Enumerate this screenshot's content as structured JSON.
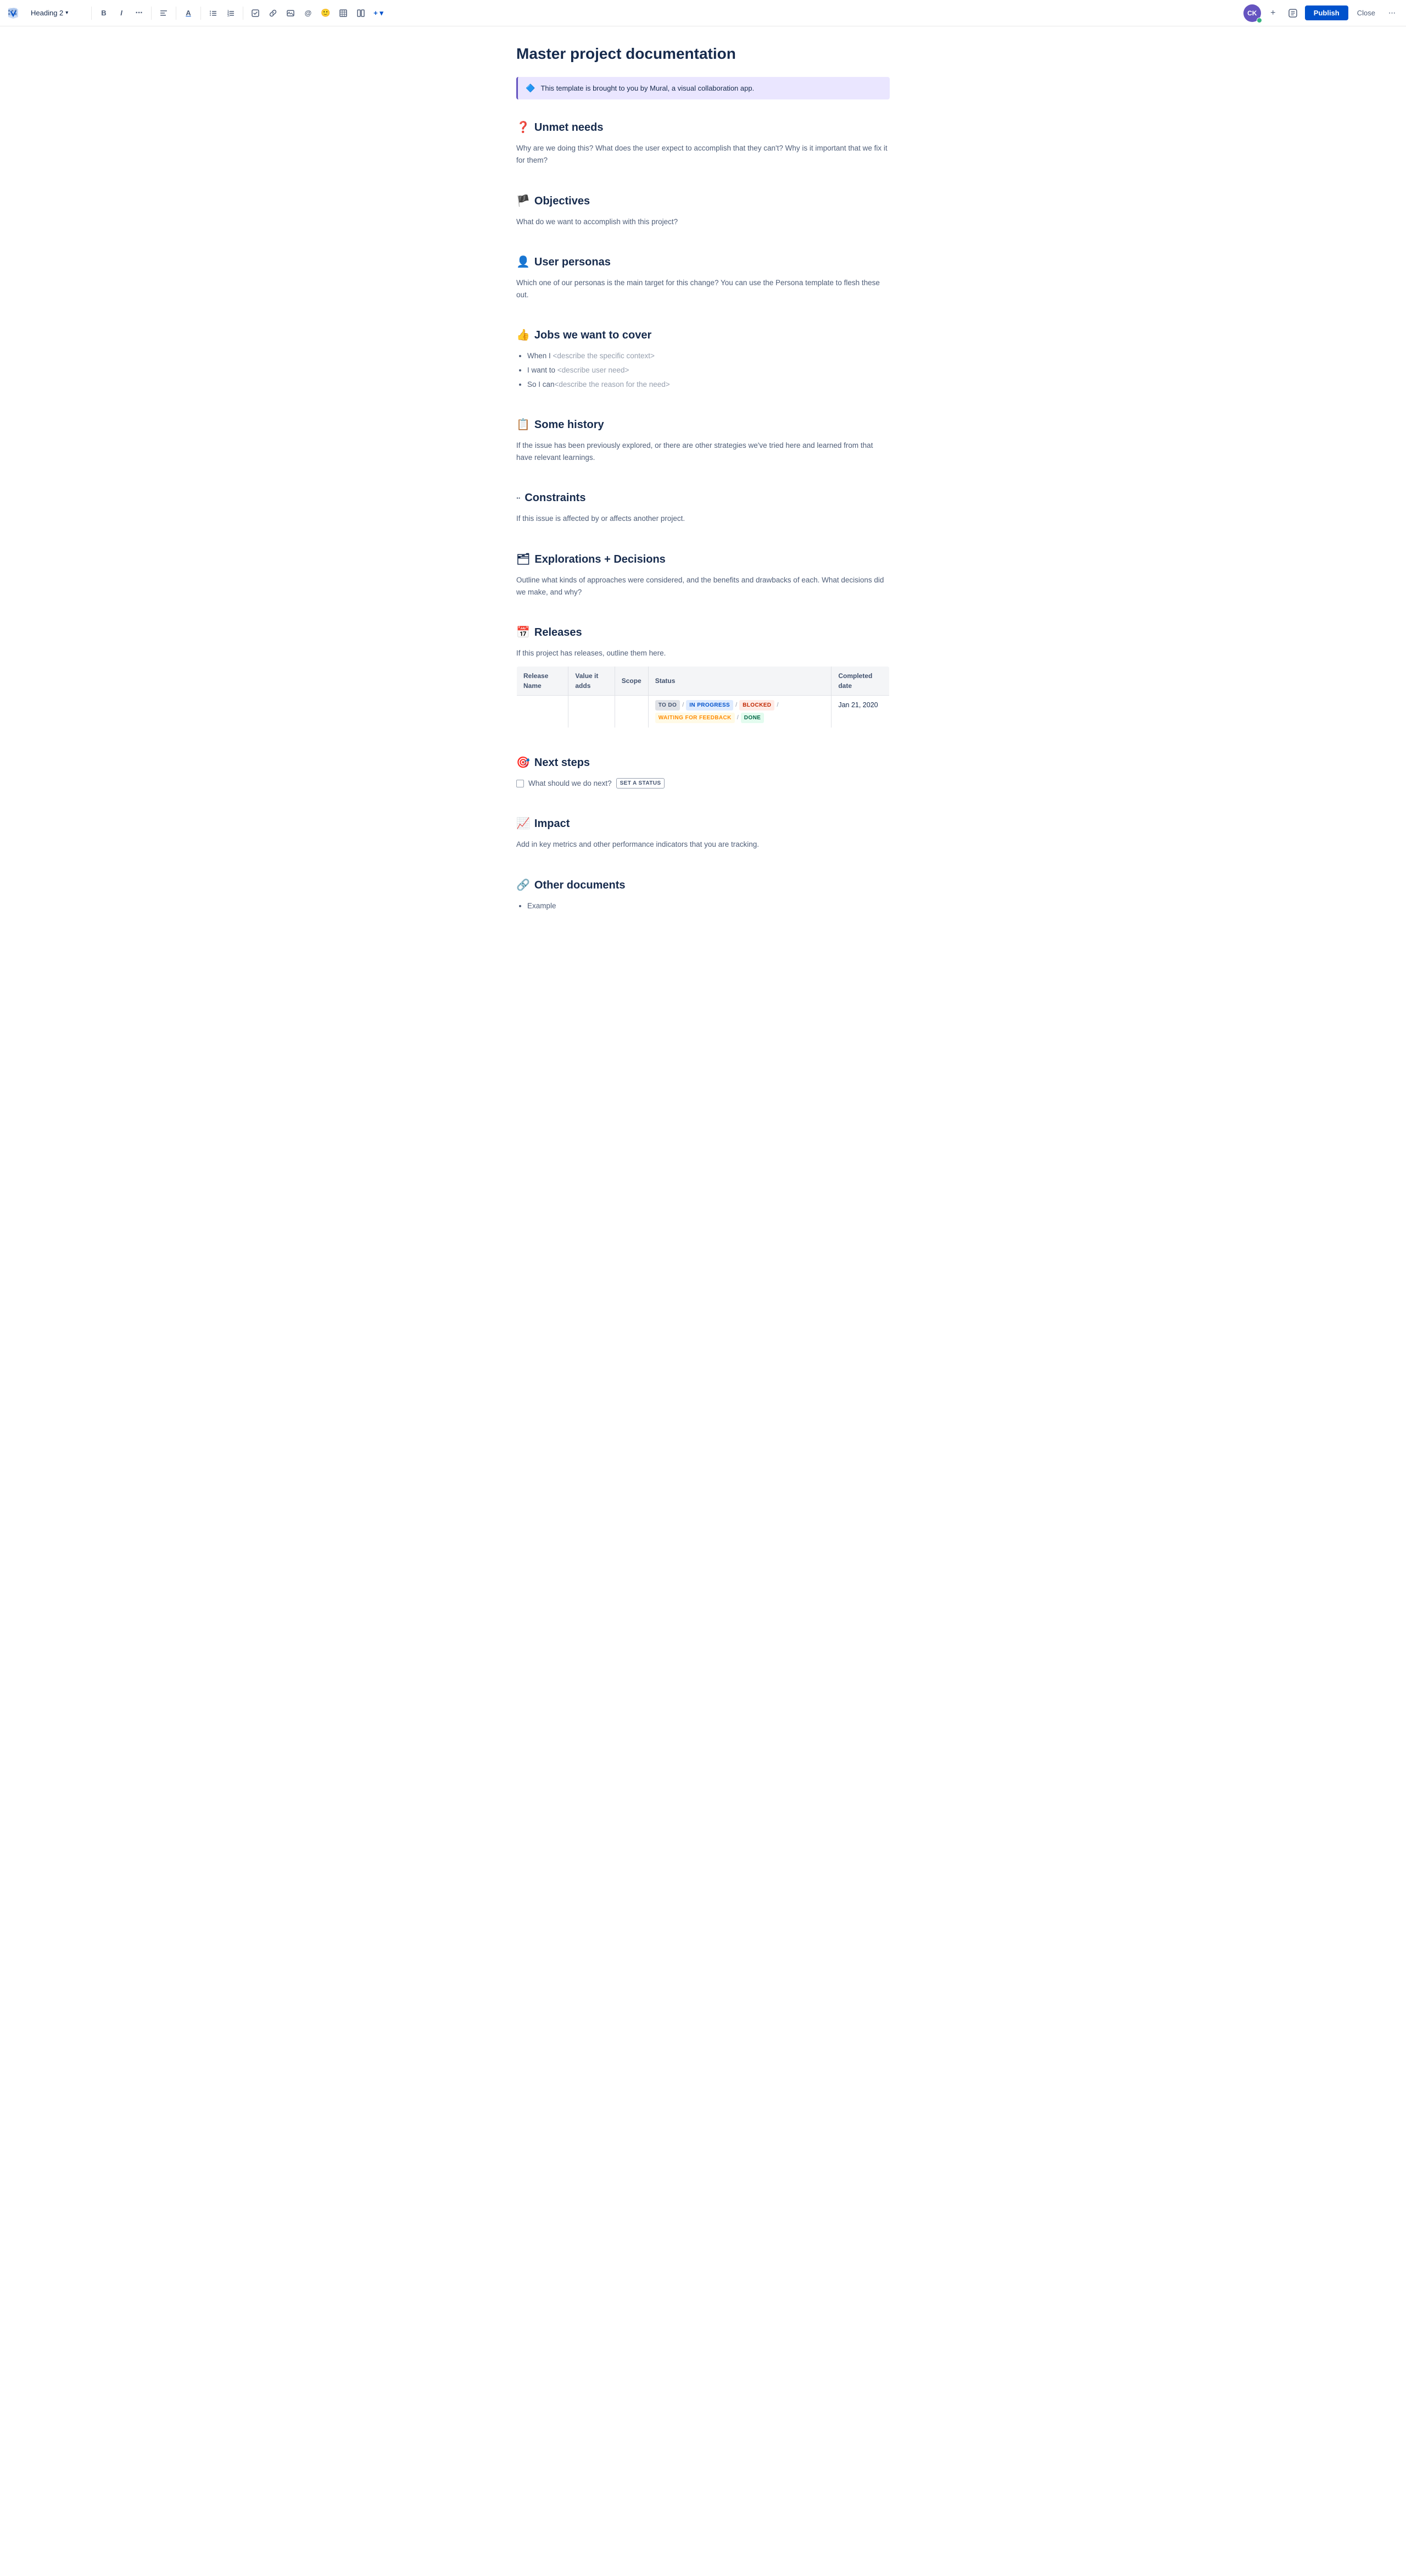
{
  "toolbar": {
    "logo_label": "Confluence",
    "heading_select_label": "Heading 2",
    "bold_label": "B",
    "italic_label": "I",
    "more_text_label": "···",
    "align_label": "≡",
    "text_color_label": "A",
    "bullet_list_label": "≡",
    "numbered_list_label": "≡",
    "task_label": "☑",
    "link_label": "🔗",
    "image_label": "🖼",
    "mention_label": "@",
    "emoji_label": "🙂",
    "table_label": "⊞",
    "column_label": "⊟",
    "insert_more_label": "+",
    "avatar_initials": "CK",
    "add_label": "+",
    "version_label": "v",
    "publish_label": "Publish",
    "close_label": "Close",
    "more_label": "···"
  },
  "page": {
    "title": "Master project documentation",
    "info_banner": {
      "icon": "🔷",
      "text": "This template is brought to you by Mural, a visual collaboration app."
    }
  },
  "sections": [
    {
      "id": "unmet-needs",
      "emoji": "❓",
      "heading": "Unmet needs",
      "body": "Why are we doing this? What does the user expect to accomplish that they can't? Why is it important that we fix it for them?"
    },
    {
      "id": "objectives",
      "emoji": "🏴",
      "heading": "Objectives",
      "body": "What do we want to accomplish with this project?"
    },
    {
      "id": "user-personas",
      "emoji": "👤",
      "heading": "User personas",
      "body": "Which one of our personas is the main target for this change? You can use the Persona template to flesh these out."
    },
    {
      "id": "jobs",
      "emoji": "👍",
      "heading": "Jobs we want to cover",
      "body": null,
      "bullets": [
        {
          "prefix": "When I ",
          "placeholder": "<describe the specific context>"
        },
        {
          "prefix": "I want to ",
          "placeholder": "<describe user need>"
        },
        {
          "prefix": "So I can",
          "placeholder": "<describe the reason for the need>"
        }
      ]
    },
    {
      "id": "some-history",
      "emoji": "📋",
      "heading": "Some history",
      "body": "If the issue has been previously explored, or there are other strategies we've tried here and learned from that have relevant learnings."
    },
    {
      "id": "constraints",
      "emoji": "··",
      "heading": "Constraints",
      "body": "If this issue is affected by or affects another project.",
      "constraints_icon": true
    },
    {
      "id": "explorations",
      "emoji": "🗂",
      "heading": "Explorations + Decisions",
      "body": "Outline what kinds of approaches were considered, and the benefits and drawbacks of each. What decisions did we make, and why?"
    },
    {
      "id": "releases",
      "emoji": "📅",
      "heading": "Releases",
      "body": "If this project has releases, outline them here.",
      "table": {
        "headers": [
          "Release Name",
          "Value it adds",
          "Scope",
          "Status",
          "Completed date"
        ],
        "rows": [
          {
            "release_name": "",
            "value_adds": "",
            "scope": "",
            "status_badges": [
              {
                "label": "TO DO",
                "type": "todo"
              },
              {
                "sep": "/"
              },
              {
                "label": "IN PROGRESS",
                "type": "inprogress"
              },
              {
                "sep": "/"
              },
              {
                "label": "BLOCKED",
                "type": "blocked"
              },
              {
                "sep": "/"
              },
              {
                "label": "WAITING FOR FEEDBACK",
                "type": "waiting"
              },
              {
                "sep": "/"
              },
              {
                "label": "DONE",
                "type": "done"
              }
            ],
            "completed_date": "Jan 21, 2020"
          }
        ]
      }
    },
    {
      "id": "next-steps",
      "emoji": "🎯",
      "heading": "Next steps",
      "body": null,
      "next_steps": {
        "checkbox_text": "What should we do next?",
        "set_status_label": "SET A STATUS"
      }
    },
    {
      "id": "impact",
      "emoji": "📈",
      "heading": "Impact",
      "body": "Add in key metrics and other performance indicators that you are tracking."
    },
    {
      "id": "other-documents",
      "emoji": "🔗",
      "heading": "Other documents",
      "body": null,
      "bullets": [
        {
          "prefix": "Example",
          "placeholder": ""
        }
      ]
    }
  ]
}
